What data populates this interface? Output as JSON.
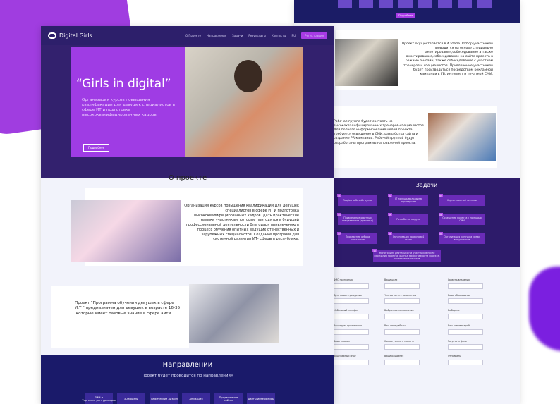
{
  "left_page": {
    "logo_text": "Digital Girls",
    "nav": [
      "О Проекте",
      "Направления",
      "Задачи",
      "Результаты",
      "Контакты",
      "RU"
    ],
    "register_label": "Регистрация",
    "hero_title": "“Girls in digital”",
    "hero_subtitle": "Организация курсов повышения квалификации для девушек специалистов в сфере ИТ и подготовка высококвалифицированных кадров",
    "hero_button": "Подробнее",
    "about_title": "О проекте",
    "about_text": "Организация курсов повышения квалификации для девушек специалистов в сфере ИТ и подготовка высококвалифицированных кадров. Дать практические навыки участникам, которые пригодятся в будущей профессиональной деятельности благодаря привлечению в процесс обучения опытных ведущих отечественных и зарубежных специалистов. Создание программ для системной развитии ИТ- сферы в республике.",
    "program_text": "Проект \"Программа обучения девушек в сфере И.Т \" предназначен для девушек в возрасте 16-35 ,которые имеет базовые знание в сфере айти.",
    "directions_title": "Направлении",
    "directions_sub": "Проект будет проводится по направлениям",
    "directions": [
      "SMM и Таргетинг,контуризация",
      "3D модели",
      "Графический дизайн",
      "Анимация",
      "Продвижение сайтов",
      "Дайты интерфейсы"
    ]
  },
  "right_page": {
    "top_button": "Подробнее",
    "card1_text": "Проект осуществляется в 4 этапа. Отбор участников проводится на основе специально анкетирования,собеседование а также анкетирование,собеседование на сайте проекта в режиме он-лайн, также собеседование с участием тренеров и специалистов. Привлечение участников будет производиться посредством рекламной кампании в ГБ, интернет и печатной СМИ.",
    "card2_text": "Рабочая группа будет состоять из высококвалифицированных тренеров-специалистов. Для полного информирования целей проекта требуется освещение в СМИ, разработка сайта и создание PR-кампании. Рабочей группой будут разработаны программы направлений проекта.",
    "tasks_title": "Задачи",
    "tasks": [
      {
        "num": "01",
        "text": "Подбор рабочей группы"
      },
      {
        "num": "02",
        "text": "IT помощь молодым в партнерстве"
      },
      {
        "num": "03",
        "text": "Курсы офисной техники"
      },
      {
        "num": "04",
        "text": "Привлечение опытных специалистов (тренинги)"
      },
      {
        "num": "05",
        "text": "Разработка модуля"
      },
      {
        "num": "06",
        "text": "Освещение проекта с помощью СМИ"
      },
      {
        "num": "07",
        "text": "Проведение отбора участников"
      },
      {
        "num": "08",
        "text": "Организация проекта в 4 этапа"
      },
      {
        "num": "09",
        "text": "Организация конкурса среди выпускников"
      },
      {
        "num": "10",
        "text": "Мониторинг деятельности участников после окончания проекта, оценка эффективности проекта, составление отчетов"
      }
    ],
    "form_col1": [
      "ФИО полностью",
      "Дата вашего рождения",
      "Мобильный телефон",
      "Ваш адрес проживания",
      "Ваши навыки",
      "Ваш учебный опыт"
    ],
    "form_col2": [
      "Ваши цели",
      "Чем вы хотите заниматься",
      "Выбранное направление",
      "Ваш опыт работы",
      "Как вы узнали о проекте",
      "Ваши ожидания"
    ],
    "form_col3": [
      "Уровень владения",
      "Ваше образование",
      "Выберите",
      "Ваш комментарий",
      "Загрузите фото",
      "Отправить"
    ]
  }
}
